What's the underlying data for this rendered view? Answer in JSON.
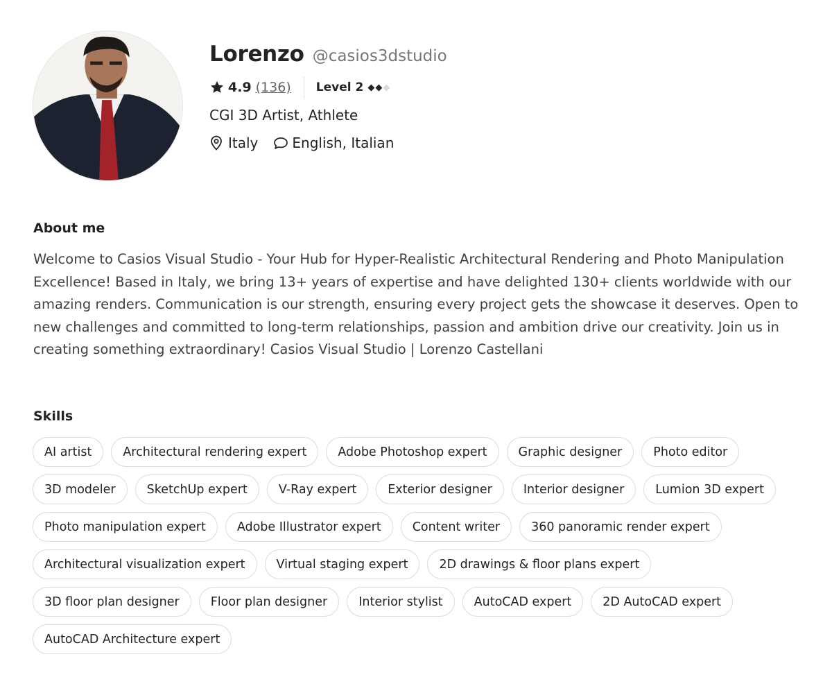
{
  "profile": {
    "name": "Lorenzo",
    "handle": "@casios3dstudio",
    "rating": "4.9",
    "review_count": "(136)",
    "level_label": "Level 2",
    "level_filled": 2,
    "level_total": 3,
    "tagline": "CGI 3D Artist, Athlete",
    "location": "Italy",
    "languages": "English, Italian",
    "icons": {
      "rating": "star-icon",
      "location": "location-pin-icon",
      "languages": "speech-bubble-icon"
    }
  },
  "about": {
    "title": "About me",
    "text": "Welcome to Casios Visual Studio - Your Hub for Hyper-Realistic Architectural Rendering and Photo Manipulation Excellence! Based in Italy, we bring 13+ years of expertise and have delighted 130+ clients worldwide with our amazing renders. Communication is our strength, ensuring every project gets the showcase it deserves. Open to new challenges and committed to long-term relationships, passion and ambition drive our creativity. Join us in creating something extraordinary! Casios Visual Studio | Lorenzo Castellani"
  },
  "skills": {
    "title": "Skills",
    "items": [
      "AI artist",
      "Architectural rendering expert",
      "Adobe Photoshop expert",
      "Graphic designer",
      "Photo editor",
      "3D modeler",
      "SketchUp expert",
      "V-Ray expert",
      "Exterior designer",
      "Interior designer",
      "Lumion 3D expert",
      "Photo manipulation expert",
      "Adobe Illustrator expert",
      "Content writer",
      "360 panoramic render expert",
      "Architectural visualization expert",
      "Virtual staging expert",
      "2D drawings & floor plans expert",
      "3D floor plan designer",
      "Floor plan designer",
      "Interior stylist",
      "AutoCAD expert",
      "2D AutoCAD expert",
      "AutoCAD Architecture expert"
    ]
  },
  "colors": {
    "text_primary": "#222325",
    "text_secondary": "#74767e",
    "chip_border": "#dadbdd",
    "diamond_off": "#dadbdd"
  }
}
